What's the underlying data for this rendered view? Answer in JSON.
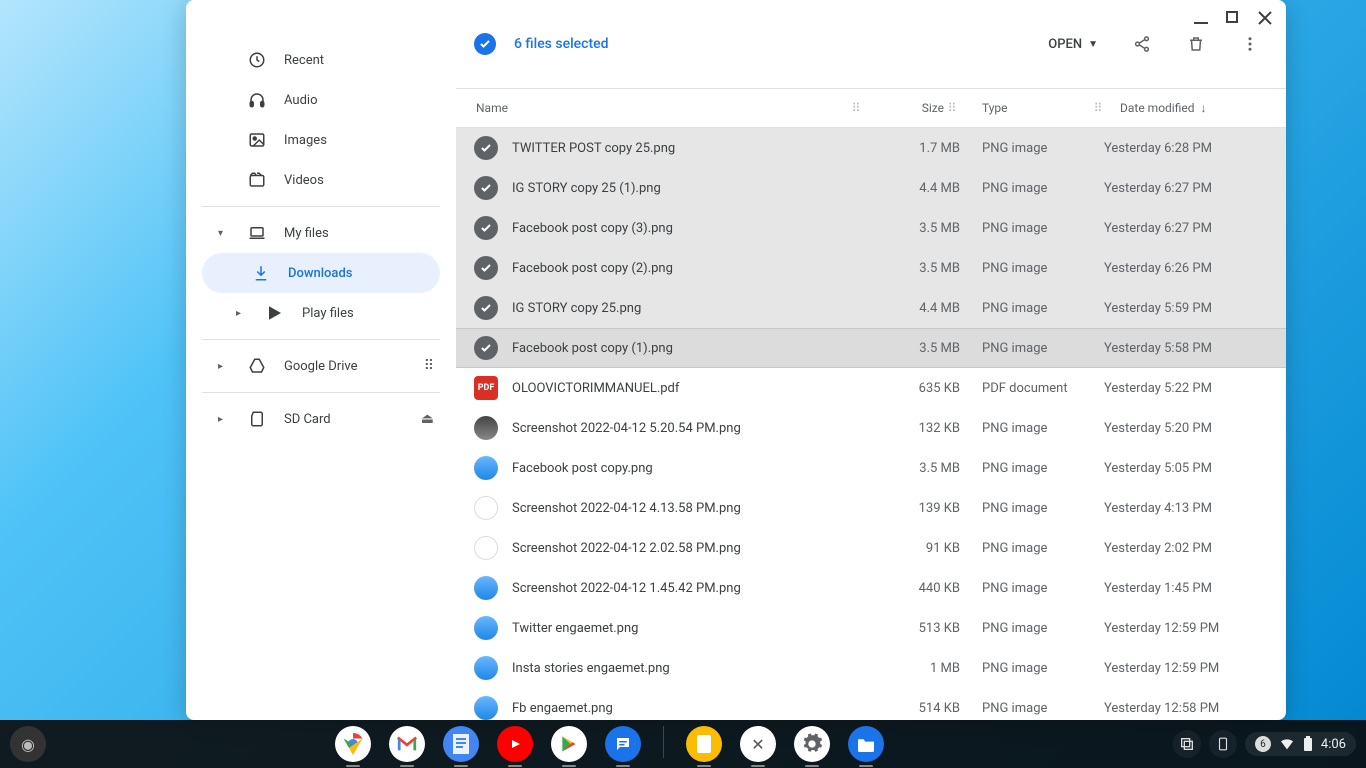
{
  "sidebar": {
    "items": [
      {
        "label": "Recent",
        "icon": "clock"
      },
      {
        "label": "Audio",
        "icon": "headphones"
      },
      {
        "label": "Images",
        "icon": "image"
      },
      {
        "label": "Videos",
        "icon": "video"
      }
    ],
    "myfiles_label": "My files",
    "downloads_label": "Downloads",
    "playfiles_label": "Play files",
    "gdrive_label": "Google Drive",
    "sdcard_label": "SD Card"
  },
  "toolbar": {
    "selection_text": "6 files selected",
    "open_label": "OPEN"
  },
  "columns": {
    "name": "Name",
    "size": "Size",
    "type": "Type",
    "date": "Date modified"
  },
  "files": [
    {
      "name": "TWITTER POST copy 25.png",
      "size": "1.7 MB",
      "type": "PNG image",
      "date": "Yesterday 6:28 PM",
      "selected": true
    },
    {
      "name": "IG STORY copy 25 (1).png",
      "size": "4.4 MB",
      "type": "PNG image",
      "date": "Yesterday 6:27 PM",
      "selected": true
    },
    {
      "name": "Facebook post copy (3).png",
      "size": "3.5 MB",
      "type": "PNG image",
      "date": "Yesterday 6:27 PM",
      "selected": true
    },
    {
      "name": "Facebook post copy (2).png",
      "size": "3.5 MB",
      "type": "PNG image",
      "date": "Yesterday 6:26 PM",
      "selected": true
    },
    {
      "name": "IG STORY copy 25.png",
      "size": "4.4 MB",
      "type": "PNG image",
      "date": "Yesterday 5:59 PM",
      "selected": true
    },
    {
      "name": "Facebook post copy (1).png",
      "size": "3.5 MB",
      "type": "PNG image",
      "date": "Yesterday 5:58 PM",
      "selected": true,
      "highlight": true
    },
    {
      "name": "OLOOVICTORIMMANUEL.pdf",
      "size": "635 KB",
      "type": "PDF document",
      "date": "Yesterday 5:22 PM",
      "thumb": "pdf"
    },
    {
      "name": "Screenshot 2022-04-12 5.20.54 PM.png",
      "size": "132 KB",
      "type": "PNG image",
      "date": "Yesterday 5:20 PM",
      "thumb": "img3"
    },
    {
      "name": "Facebook post copy.png",
      "size": "3.5 MB",
      "type": "PNG image",
      "date": "Yesterday 5:05 PM",
      "thumb": "img"
    },
    {
      "name": "Screenshot 2022-04-12 4.13.58 PM.png",
      "size": "139 KB",
      "type": "PNG image",
      "date": "Yesterday 4:13 PM",
      "thumb": "img2"
    },
    {
      "name": "Screenshot 2022-04-12 2.02.58 PM.png",
      "size": "91 KB",
      "type": "PNG image",
      "date": "Yesterday 2:02 PM",
      "thumb": "img2"
    },
    {
      "name": "Screenshot 2022-04-12 1.45.42 PM.png",
      "size": "440 KB",
      "type": "PNG image",
      "date": "Yesterday 1:45 PM",
      "thumb": "img"
    },
    {
      "name": "Twitter engaemet.png",
      "size": "513 KB",
      "type": "PNG image",
      "date": "Yesterday 12:59 PM",
      "thumb": "img"
    },
    {
      "name": "Insta stories engaemet.png",
      "size": "1 MB",
      "type": "PNG image",
      "date": "Yesterday 12:59 PM",
      "thumb": "img"
    },
    {
      "name": "Fb engaemet.png",
      "size": "514 KB",
      "type": "PNG image",
      "date": "Yesterday 12:58 PM",
      "thumb": "img"
    }
  ],
  "shelf": {
    "notification_count": "6",
    "clock": "4:06"
  }
}
